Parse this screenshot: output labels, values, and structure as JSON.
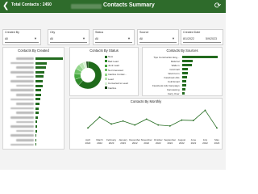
{
  "header": {
    "total_contacts": "Total Contacts : 2450",
    "title": "Contacts Summary"
  },
  "filters": [
    {
      "label": "Created By",
      "value": "All"
    },
    {
      "label": "City",
      "value": "All"
    },
    {
      "label": "Status",
      "value": "All"
    },
    {
      "label": "Source",
      "value": "All"
    },
    {
      "label": "Created Date",
      "value": "8/1/2022",
      "value2": "5/9/2023"
    }
  ],
  "panels": {
    "created_by": "Contacts By Created",
    "status": "Contacts By Status",
    "sources": "Contacts By Sources",
    "monthly": "Contacts By Monthly"
  },
  "colors": {
    "header": "#2e6b2b",
    "bar": "#236b1f"
  },
  "chart_data": [
    {
      "type": "bar",
      "title": "Contacts By Created",
      "orientation": "horizontal",
      "values": [
        1.0,
        0.42,
        0.38,
        0.33,
        0.3,
        0.27,
        0.25,
        0.22,
        0.2,
        0.18,
        0.15,
        0.13,
        0.11,
        0.09,
        0.07,
        0.06,
        0.05,
        0.04,
        0.03,
        0.02
      ]
    },
    {
      "type": "pie",
      "title": "Contacts By Status",
      "legend": [
        "New",
        "Bad Lead",
        "Junk Lead",
        "Not Interested",
        "Inactive Contac...",
        "Lead",
        "Converted to Lead",
        "Inactive"
      ],
      "values": [
        62,
        8,
        7,
        6,
        6,
        5,
        4,
        2
      ],
      "colors": [
        "#1f6a1b",
        "#2f8a2a",
        "#46a83f",
        "#6cc164",
        "#94d68c",
        "#b9e5b3",
        "#d7f0d3",
        "#0f3f0c"
      ]
    },
    {
      "type": "bar",
      "title": "Contacts By Sources",
      "orientation": "horizontal",
      "categories": [
        "Tipo Construction Eng...",
        "Referral",
        "Walk-in",
        "Cold Call",
        "Web Form",
        "Facebook Ads",
        "Cold Email",
        "Facebook Ads Campaign",
        "Canvassing",
        "Carry Over"
      ],
      "values": [
        1.0,
        0.29,
        0.27,
        0.17,
        0.15,
        0.13,
        0.12,
        0.11,
        0.09,
        0.06
      ]
    },
    {
      "type": "line",
      "title": "Contacts By Monthly",
      "categories": [
        "April 2022",
        "March 2022",
        "February 2023",
        "January 2023",
        "December 2022",
        "November 2022",
        "October 2022",
        "September 2022",
        "August 2022",
        "June 2022",
        "July 2022",
        "May 2023"
      ],
      "values": [
        40,
        95,
        60,
        75,
        55,
        85,
        55,
        50,
        80,
        78,
        130,
        40
      ]
    }
  ]
}
